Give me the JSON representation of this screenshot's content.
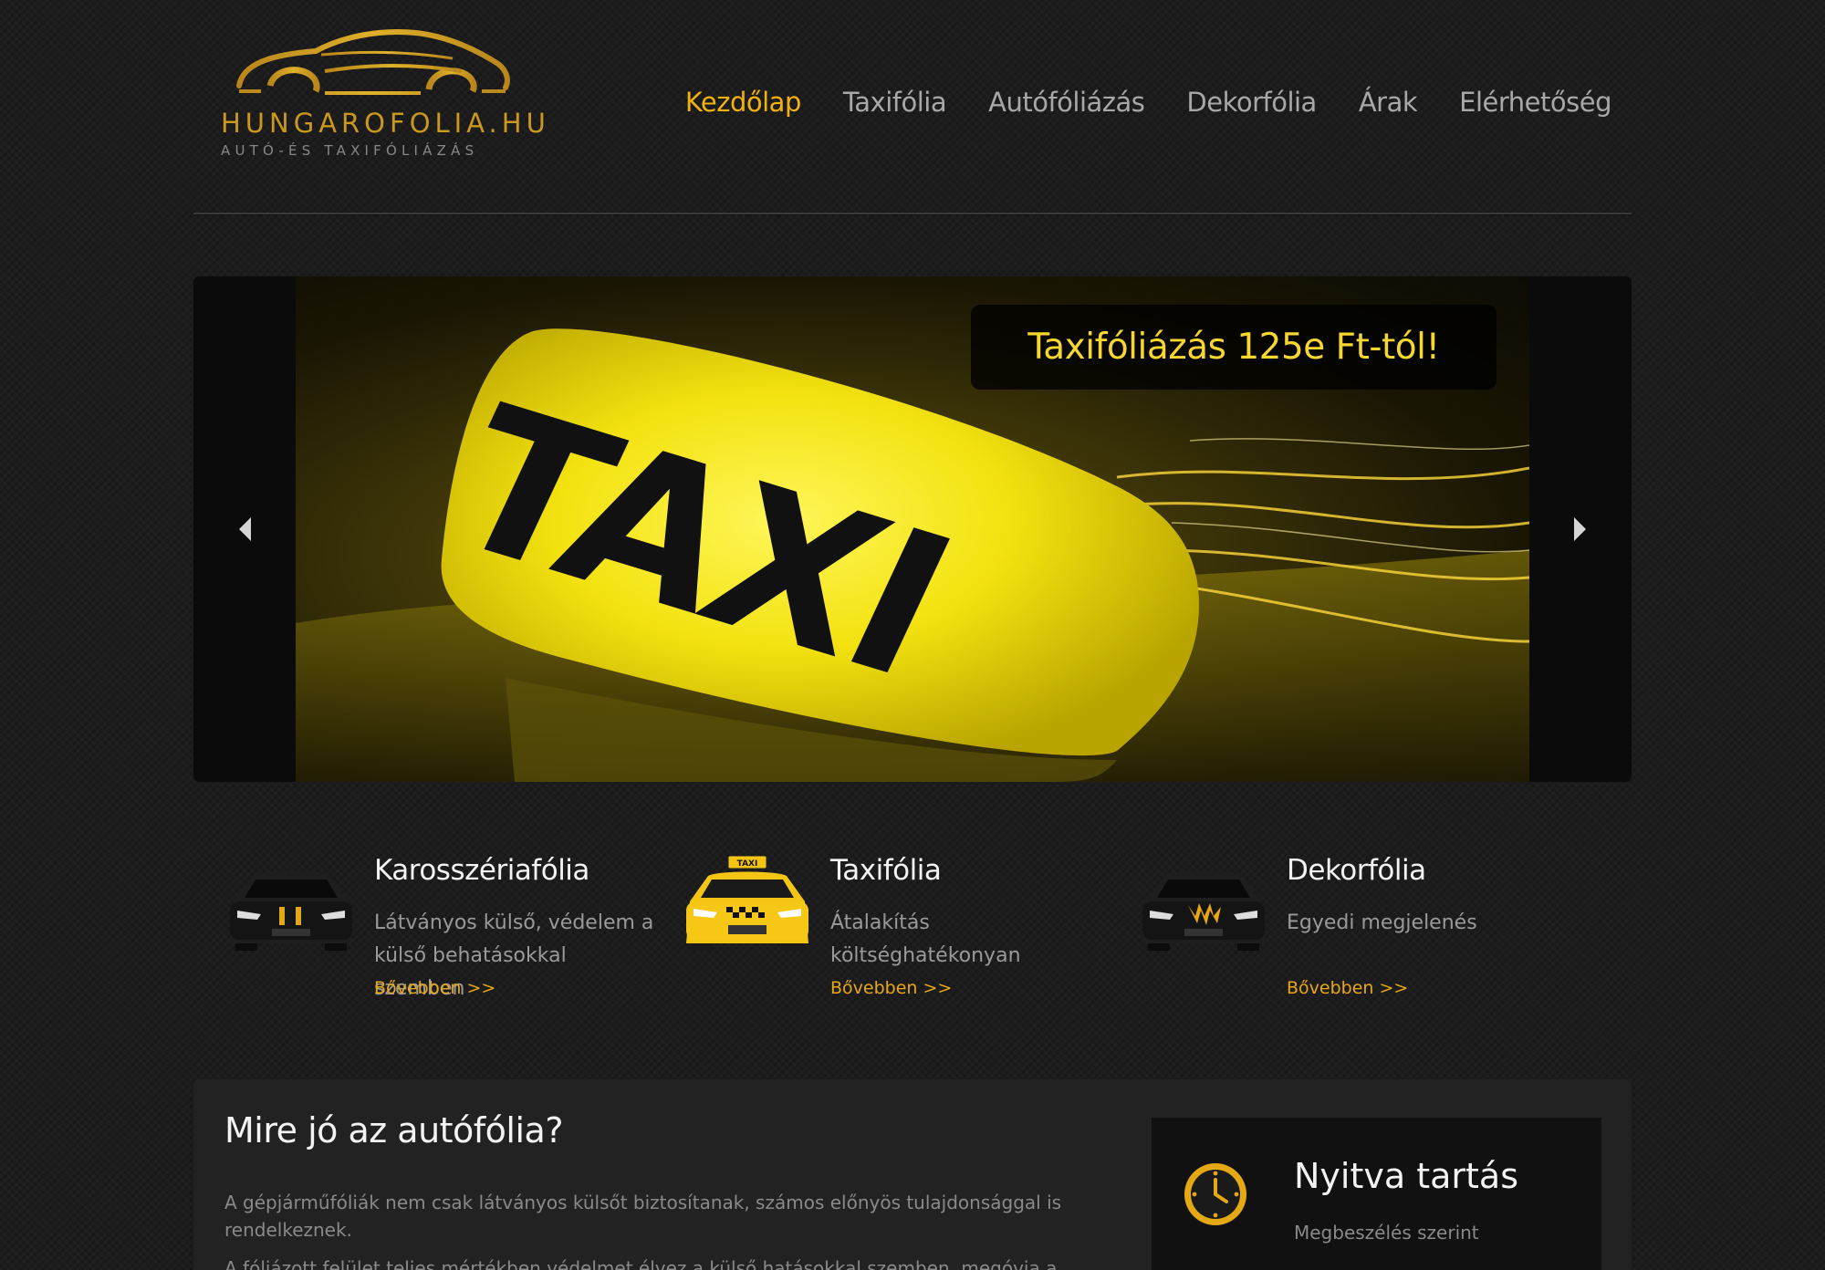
{
  "brand": {
    "name": "HUNGAROFOLIA.HU",
    "tagline": "Autó-és taxifóliázás"
  },
  "nav": {
    "items": [
      {
        "label": "Kezdőlap",
        "active": true
      },
      {
        "label": "Taxifólia",
        "active": false
      },
      {
        "label": "Autófóliázás",
        "active": false
      },
      {
        "label": "Dekorfólia",
        "active": false
      },
      {
        "label": "Árak",
        "active": false
      },
      {
        "label": "Elérhetőség",
        "active": false
      }
    ]
  },
  "slider": {
    "caption": "Taxifóliázás 125e Ft-tól!",
    "sign_text": "TAXI",
    "prev_icon": "arrow-left-icon",
    "next_icon": "arrow-right-icon"
  },
  "features": [
    {
      "title": "Karosszériafólia",
      "text": "Látványos külső, védelem a külső behatásokkal szemben",
      "link": "Bővebben >>",
      "icon": "black-car-icon"
    },
    {
      "title": "Taxifólia",
      "text": "Átalakítás költséghatékonyan",
      "link": "Bővebben >>",
      "icon": "taxi-car-icon"
    },
    {
      "title": "Dekorfólia",
      "text": "Egyedi megjelenés",
      "link": "Bővebben >>",
      "icon": "decor-car-icon"
    }
  ],
  "article": {
    "title": "Mire jó az autófólia?",
    "paragraph1": "A gépjárműfóliák nem csak látványos külsőt biztosítanak, számos előnyös tulajdonsággal is rendelkeznek.",
    "paragraph2": "A fóliázott felület teljes mértékben védelmet élvez a külső hatásokkal szemben, megóvja a fényezést a"
  },
  "hours": {
    "title": "Nyitva tartás",
    "text": "Megbeszélés szerint",
    "icon": "clock-icon"
  },
  "colors": {
    "accent": "#f2b20e",
    "background": "#1c1c1c",
    "nav_text": "#a8a8a8"
  }
}
